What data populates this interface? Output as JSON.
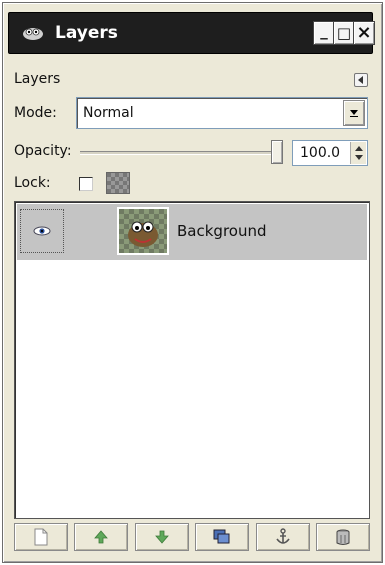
{
  "window": {
    "title": "Layers",
    "controls": {
      "minimize": "_",
      "maximize": "□",
      "close": "×"
    }
  },
  "panel": {
    "heading": "Layers",
    "mode_label": "Mode:",
    "mode_value": "Normal",
    "opacity_label": "Opacity:",
    "opacity_value": "100.0",
    "opacity_percent": 100,
    "lock_label": "Lock:",
    "lock_pixels_checked": false
  },
  "layers": [
    {
      "name": "Background",
      "visible": true,
      "selected": true
    }
  ],
  "bottom_buttons": [
    {
      "name": "new-layer-button",
      "icon": "new-document-icon"
    },
    {
      "name": "raise-layer-button",
      "icon": "arrow-up-icon"
    },
    {
      "name": "lower-layer-button",
      "icon": "arrow-down-icon"
    },
    {
      "name": "duplicate-layer-button",
      "icon": "duplicate-icon"
    },
    {
      "name": "anchor-layer-button",
      "icon": "anchor-icon"
    },
    {
      "name": "delete-layer-button",
      "icon": "trash-icon"
    }
  ],
  "colors": {
    "titlebar": "#1e1e1e",
    "panel_bg": "#ece9d8",
    "selected_row": "#c4c4c4",
    "arrow_green": "#5fa85a"
  }
}
